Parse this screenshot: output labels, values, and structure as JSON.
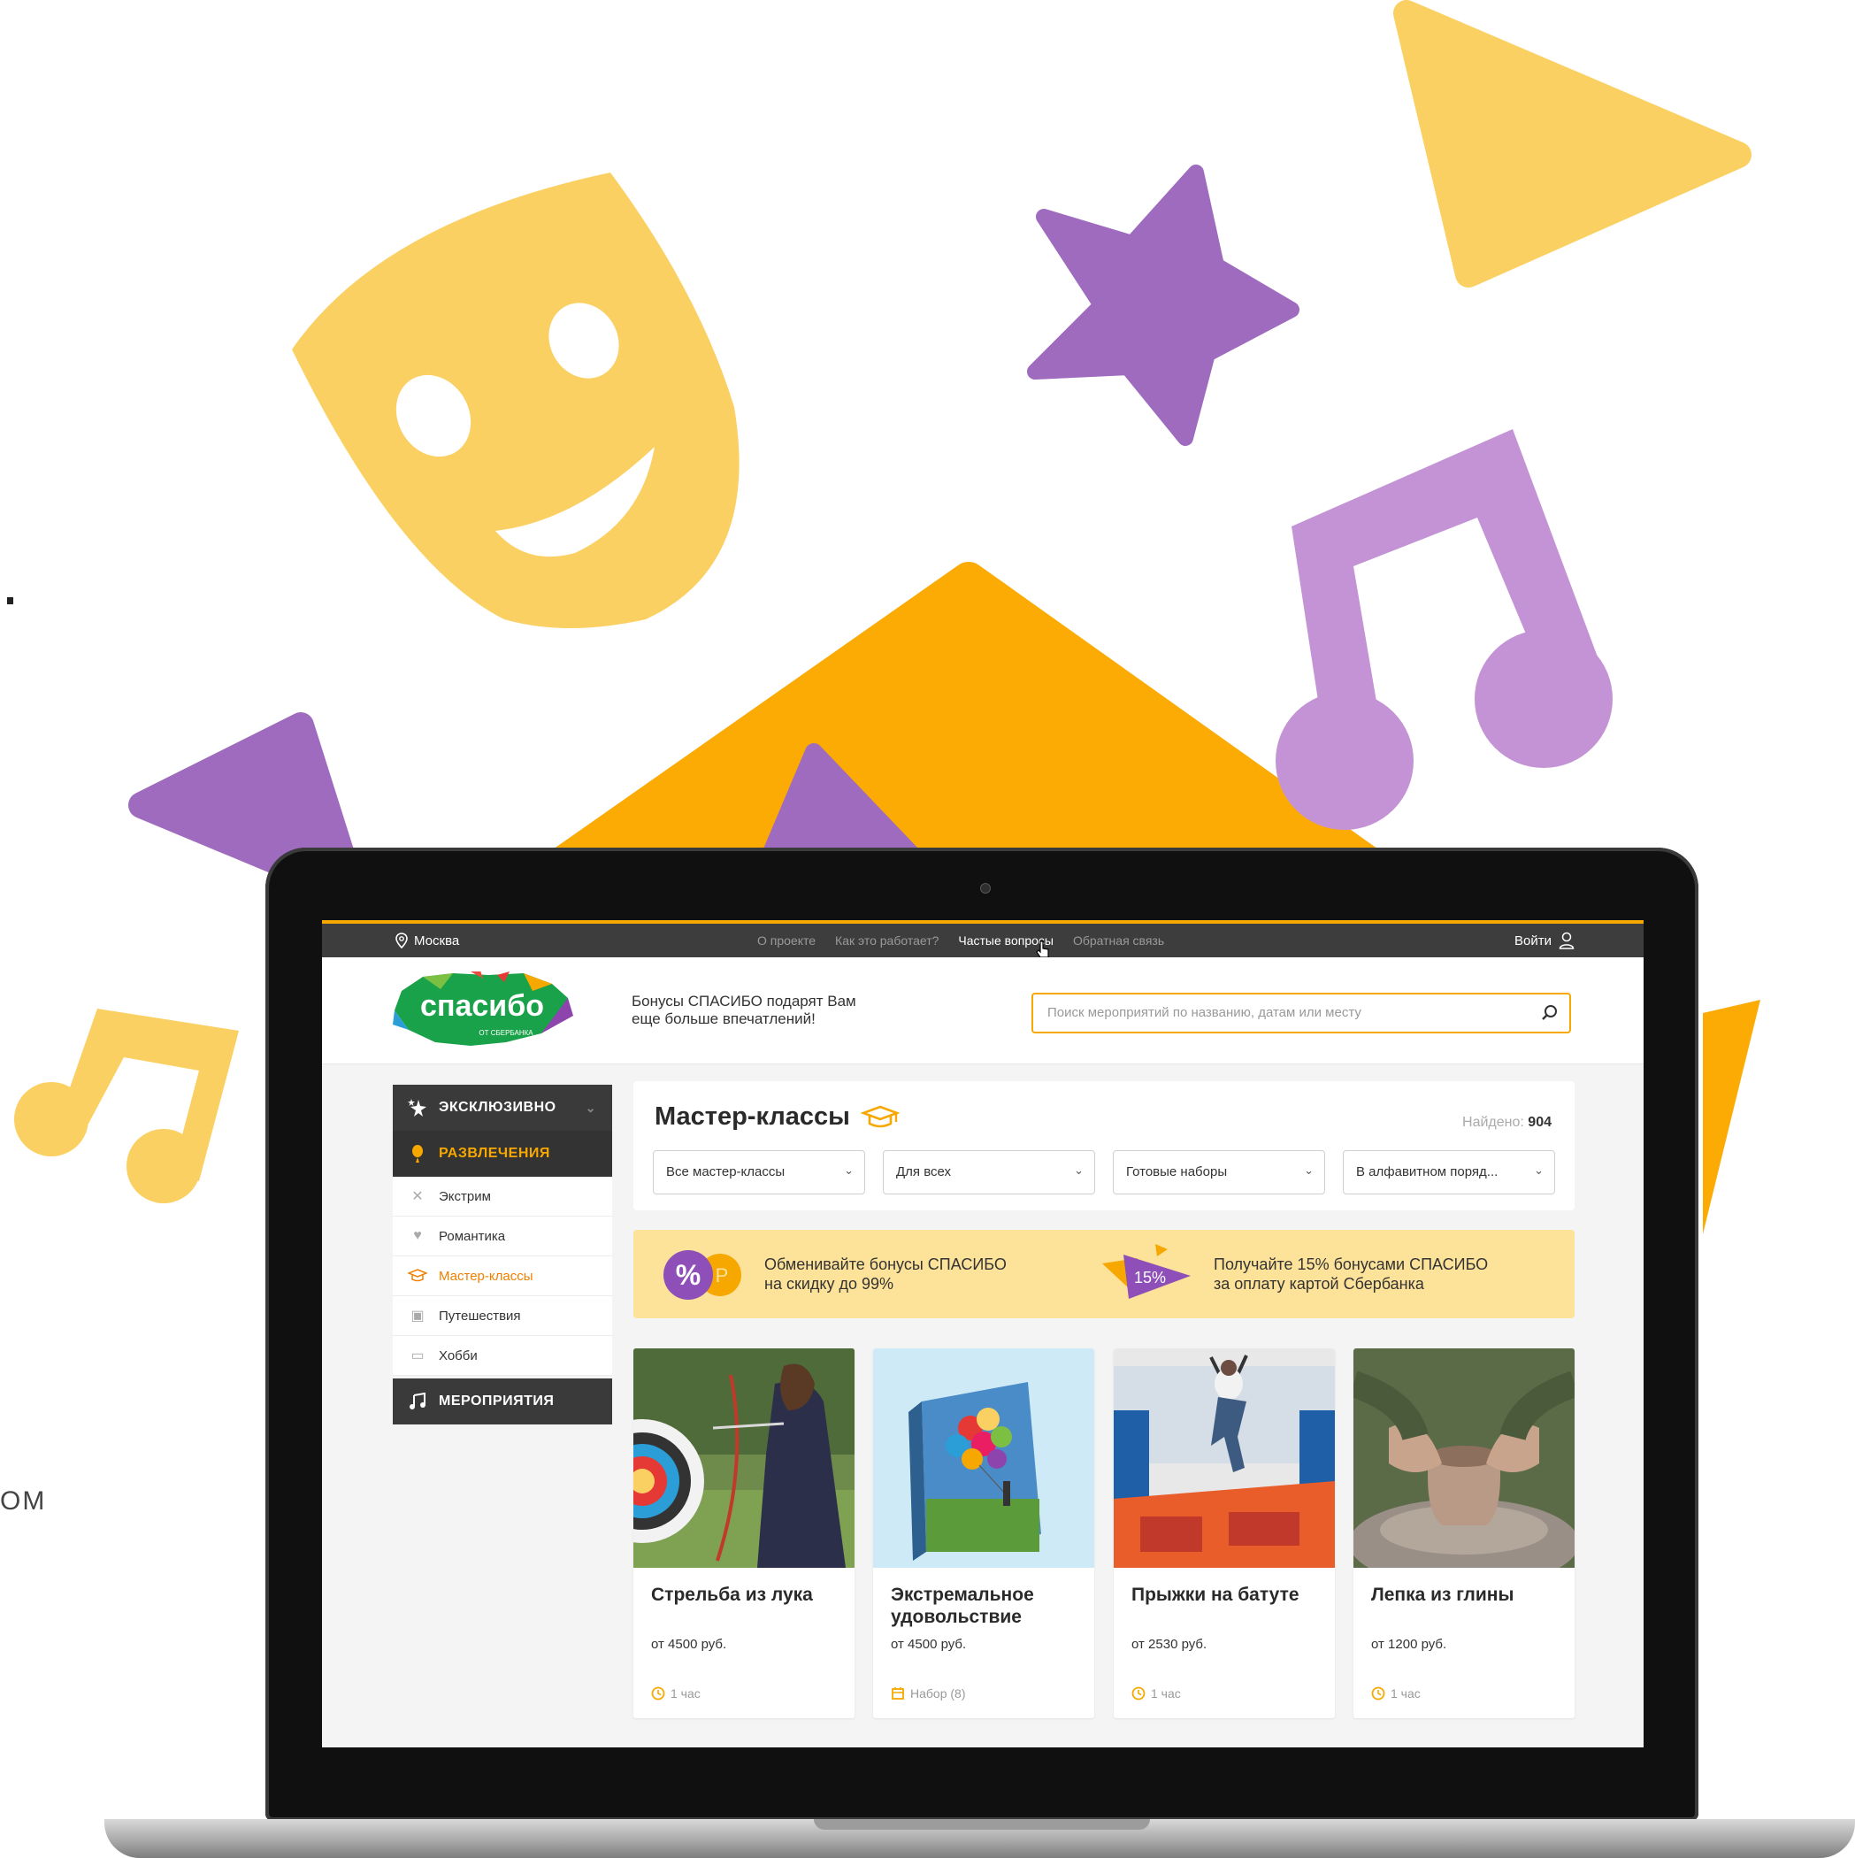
{
  "edge_text": "OM",
  "topbar": {
    "city": "Москва",
    "nav": [
      "О проекте",
      "Как это работает?",
      "Частые вопросы",
      "Обратная связь"
    ],
    "active_nav": "Частые вопросы",
    "login": "Войти"
  },
  "header": {
    "logo_text": "спасибо",
    "logo_subtext": "ОТ СБЕРБАНКА",
    "tagline_line1": "Бонусы СПАСИБО подарят Вам",
    "tagline_line2": "еще больше впечатлений!",
    "search_placeholder": "Поиск мероприятий по названию, датам или месту"
  },
  "sidebar": {
    "exclusive": "ЭКСКЛЮЗИВНО",
    "entertainment": "РАЗВЛЕЧЕНИЯ",
    "items": [
      {
        "label": "Экстрим",
        "icon": "extreme-icon"
      },
      {
        "label": "Романтика",
        "icon": "romance-icon"
      },
      {
        "label": "Мастер-классы",
        "icon": "graduation-cap-icon",
        "active": true
      },
      {
        "label": "Путешествия",
        "icon": "travel-icon"
      },
      {
        "label": "Хобби",
        "icon": "hobby-icon"
      }
    ],
    "events": "МЕРОПРИЯТИЯ"
  },
  "main": {
    "title": "Мастер-классы",
    "found_label": "Найдено:",
    "found_count": "904",
    "filters": [
      "Все мастер-классы",
      "Для всех",
      "Готовые наборы",
      "В алфавитном поряд..."
    ]
  },
  "promo": {
    "left_badge": "%",
    "left_line1": "Обменивайте бонусы СПАСИБО",
    "left_line2": "на скидку до 99%",
    "right_badge": "15%",
    "right_line1": "Получайте 15% бонусами СПАСИБО",
    "right_line2": "за оплату картой Сбербанка"
  },
  "cards": [
    {
      "title": "Стрельба из лука",
      "price": "от 4500 руб.",
      "meta": "1 час",
      "meta_icon": "clock-icon"
    },
    {
      "title": "Экстремальное удовольствие",
      "price": "от 4500 руб.",
      "meta": "Набор (8)",
      "meta_icon": "calendar-icon"
    },
    {
      "title": "Прыжки на батуте",
      "price": "от 2530 руб.",
      "meta": "1 час",
      "meta_icon": "clock-icon"
    },
    {
      "title": "Лепка из глины",
      "price": "от 1200 руб.",
      "meta": "1 час",
      "meta_icon": "clock-icon"
    }
  ],
  "colors": {
    "accent_orange": "#f7a800",
    "yellow": "#fbd062",
    "purple": "#9e6bbf",
    "light_purple": "#c493d6",
    "dark_bar": "#3d3d3d"
  }
}
